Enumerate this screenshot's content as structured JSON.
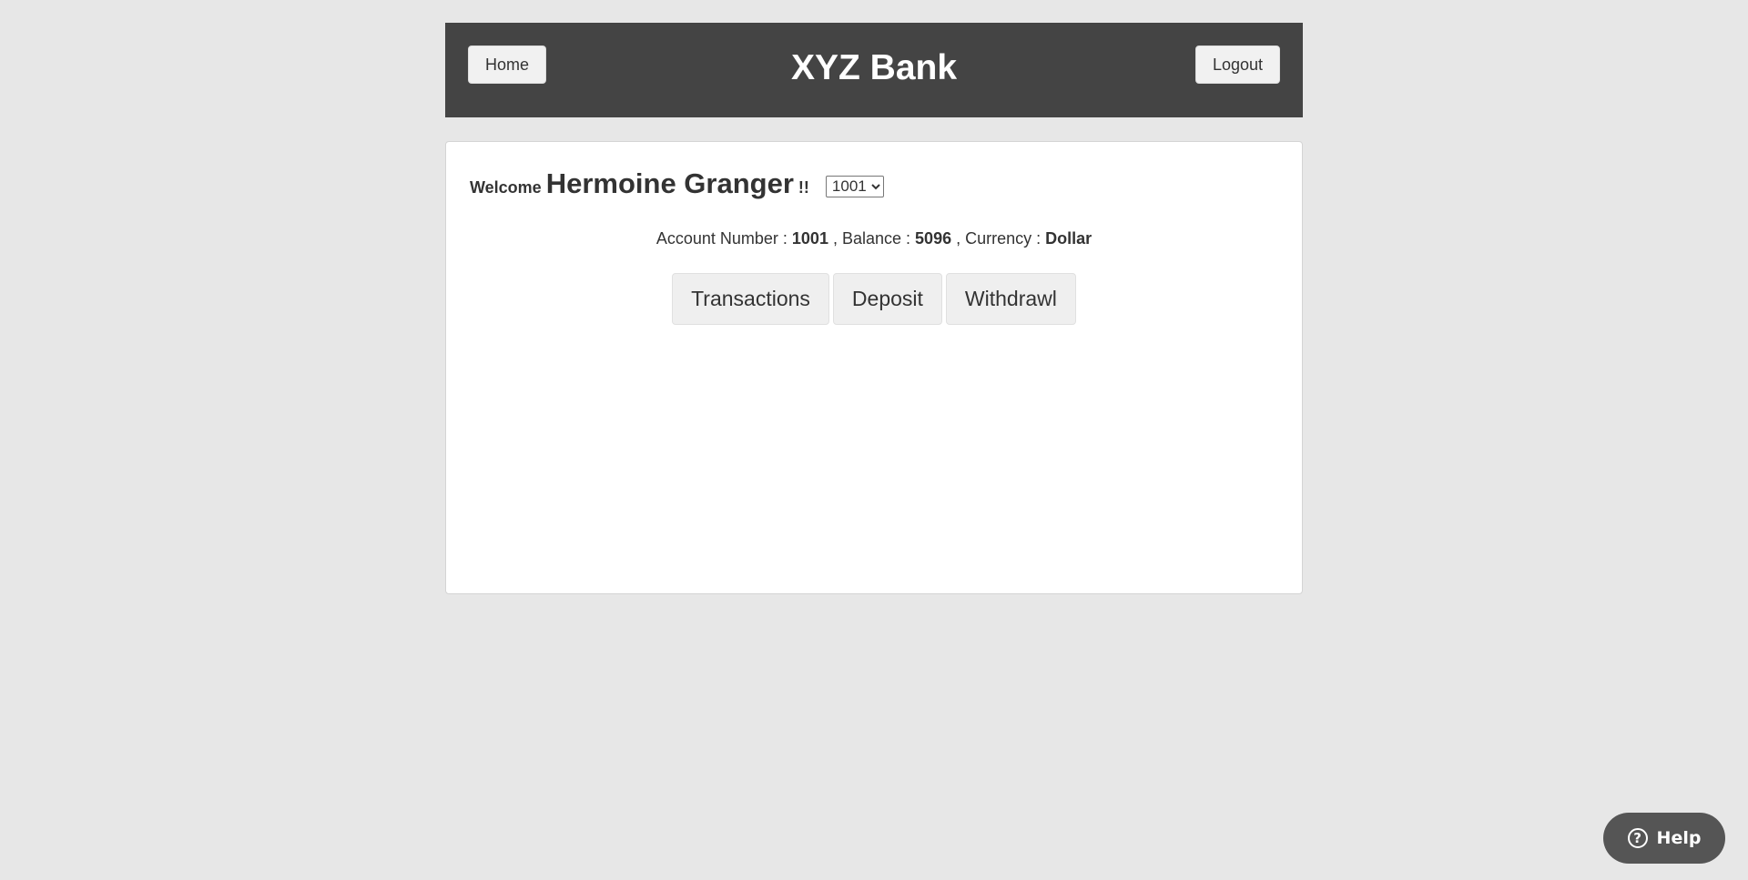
{
  "header": {
    "title": "XYZ Bank",
    "home_label": "Home",
    "logout_label": "Logout"
  },
  "welcome": {
    "prefix": "Welcome",
    "customer_name": "Hermoine Granger",
    "suffix": "!!",
    "selected_account": "1001"
  },
  "account_info": {
    "number_label": "Account Number :",
    "number": "1001",
    "balance_label": ", Balance :",
    "balance": "5096",
    "currency_label": ", Currency :",
    "currency": "Dollar"
  },
  "actions": {
    "transactions_label": "Transactions",
    "deposit_label": "Deposit",
    "withdrawl_label": "Withdrawl"
  },
  "help": {
    "label": "Help",
    "icon": "question-circle-icon"
  }
}
